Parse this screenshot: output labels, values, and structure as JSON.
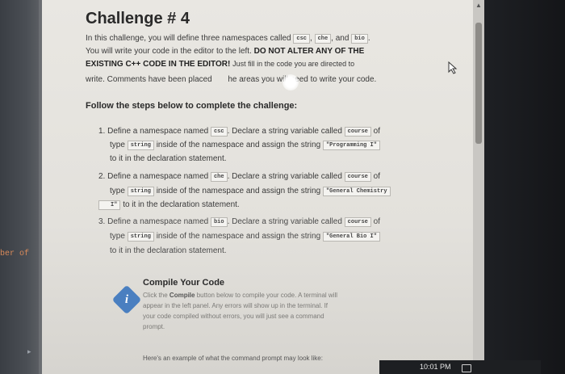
{
  "editor": {
    "code_fragment": "ber of"
  },
  "challenge": {
    "title": "Challenge # 4",
    "intro": {
      "line1_before": "In this challenge, you will define three namespaces called",
      "ns_csc": "csc",
      "sep1": ",",
      "ns_che": "che",
      "sep2": ", and",
      "ns_bio": "bio",
      "sep3": ".",
      "line2_normal": "You will write your code in the editor to the left.",
      "line2_bold": "DO NOT ALTER ANY OF THE",
      "line3_bold": "EXISTING C++ CODE IN THE EDITOR!",
      "line3_normal": "Just fill in the code you are directed to",
      "line4_before": "write. Comments have been placed",
      "line4_after": "he areas you will need to write your code."
    },
    "steps_heading": "Follow the steps below to complete the challenge:",
    "steps": [
      {
        "p1": "1. Define a namespace named",
        "ns": "csc",
        "p2": ". Declare a string variable called",
        "var": "course",
        "p3": "of",
        "p4": "type",
        "type": "string",
        "p5": "inside of the namespace and assign the string",
        "value": "\"Programming I\"",
        "p6": "to it in the declaration statement."
      },
      {
        "p1": "2. Define a namespace named",
        "ns": "che",
        "p2": ". Declare a string variable called",
        "var": "course",
        "p3": "of",
        "p4": "type",
        "type": "string",
        "p5": "inside of the namespace and assign the string",
        "value": "\"General Chemistry",
        "value_cont": "I\"",
        "p6": "to it in the declaration statement."
      },
      {
        "p1": "3. Define a namespace named",
        "ns": "bio",
        "p2": ". Declare a string variable called",
        "var": "course",
        "p3": "of",
        "p4": "type",
        "type": "string",
        "p5": "inside of the namespace and assign the string",
        "value": "\"General Bio I\"",
        "p6": "to it in the declaration statement."
      }
    ],
    "compile": {
      "title": "Compile Your Code",
      "line1_before": "Click the",
      "line1_bold": "Compile",
      "line1_after": "button below to compile your code. A terminal will",
      "line2": "appear in the left panel. Any errors will show up in the terminal. If",
      "line3": "your code compiled without errors, you will just see a command",
      "line4": "prompt."
    },
    "example": "Here's an example of what the command prompt may look like:"
  },
  "taskbar": {
    "clock": "10:01 PM"
  },
  "icons": {
    "compile": "info-diamond-icon",
    "cursor": "mouse-pointer-icon",
    "scroll": "scroll-up-arrow-icon",
    "tray": "notification-icon",
    "left_arrow": "expand-arrow-icon"
  },
  "colors": {
    "content_bg": "#e9e7e2",
    "compile_icon": "#4a7fc0",
    "editor_text": "#d98a5a"
  }
}
